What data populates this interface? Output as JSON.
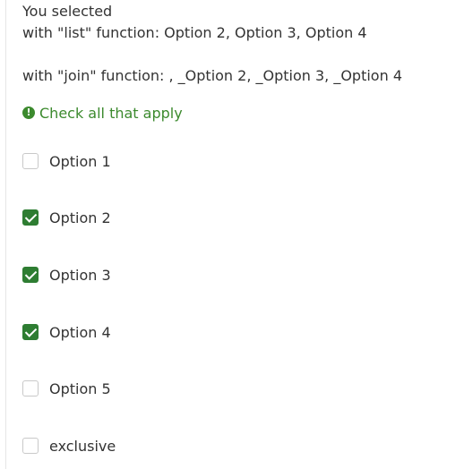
{
  "summary": {
    "heading": "You selected",
    "list_line": "with \"list\" function: Option 2, Option 3, Option 4",
    "join_line": "with \"join\" function: , _Option 2, _Option 3, _Option 4"
  },
  "hint": {
    "icon": "info-circle-icon",
    "text": "Check all that apply",
    "color": "#3c8a2e"
  },
  "options": [
    {
      "label": "Option 1",
      "checked": false
    },
    {
      "label": "Option 2",
      "checked": true
    },
    {
      "label": "Option 3",
      "checked": true
    },
    {
      "label": "Option 4",
      "checked": true
    },
    {
      "label": "Option 5",
      "checked": false
    },
    {
      "label": "exclusive",
      "checked": false
    }
  ],
  "colors": {
    "checked_fill": "#2e7d32",
    "unchecked_border": "#c9c9c9",
    "text": "#333333"
  }
}
